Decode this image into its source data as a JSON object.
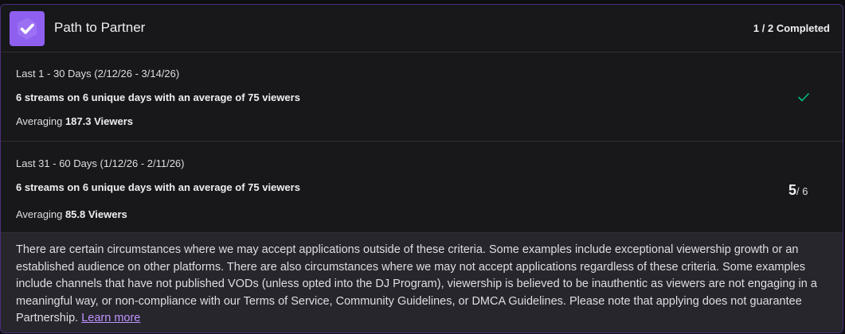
{
  "header": {
    "title": "Path to Partner",
    "completed": "1 / 2 Completed",
    "badge_icon": "partner-check-icon",
    "badge_color": "#8f5ff0"
  },
  "criteria": [
    {
      "period": "Last 1 - 30 Days (2/12/26 - 3/14/26)",
      "requirement": "6 streams on 6 unique days with an average of 75 viewers",
      "averaging_prefix": "Averaging",
      "averaging_value": "187.3 Viewers",
      "status": "complete",
      "status_icon": "checkmark-icon",
      "status_color": "#00c07e"
    },
    {
      "period": "Last 31 - 60 Days (1/12/26 - 2/11/26)",
      "requirement": "6 streams on 6 unique days with an average of 75 viewers",
      "averaging_prefix": "Averaging",
      "averaging_value": "85.8 Viewers",
      "status": "in-progress",
      "progress_current": "5",
      "progress_total": "/ 6"
    }
  ],
  "footer": {
    "disclaimer": "There are certain circumstances where we may accept applications outside of these criteria. Some examples include exceptional viewership growth or an established audience on other platforms. There are also circumstances where we may not accept applications regardless of these criteria. Some examples include channels that have not published VODs (unless opted into the DJ Program), viewership is believed to be inauthentic as viewers are not engaging in a meaningful way, or non-compliance with our Terms of Service, Community Guidelines, or DMCA Guidelines. Please note that applying does not guarantee Partnership.",
    "learn_more": "Learn more",
    "link_color": "#bf94ff"
  }
}
